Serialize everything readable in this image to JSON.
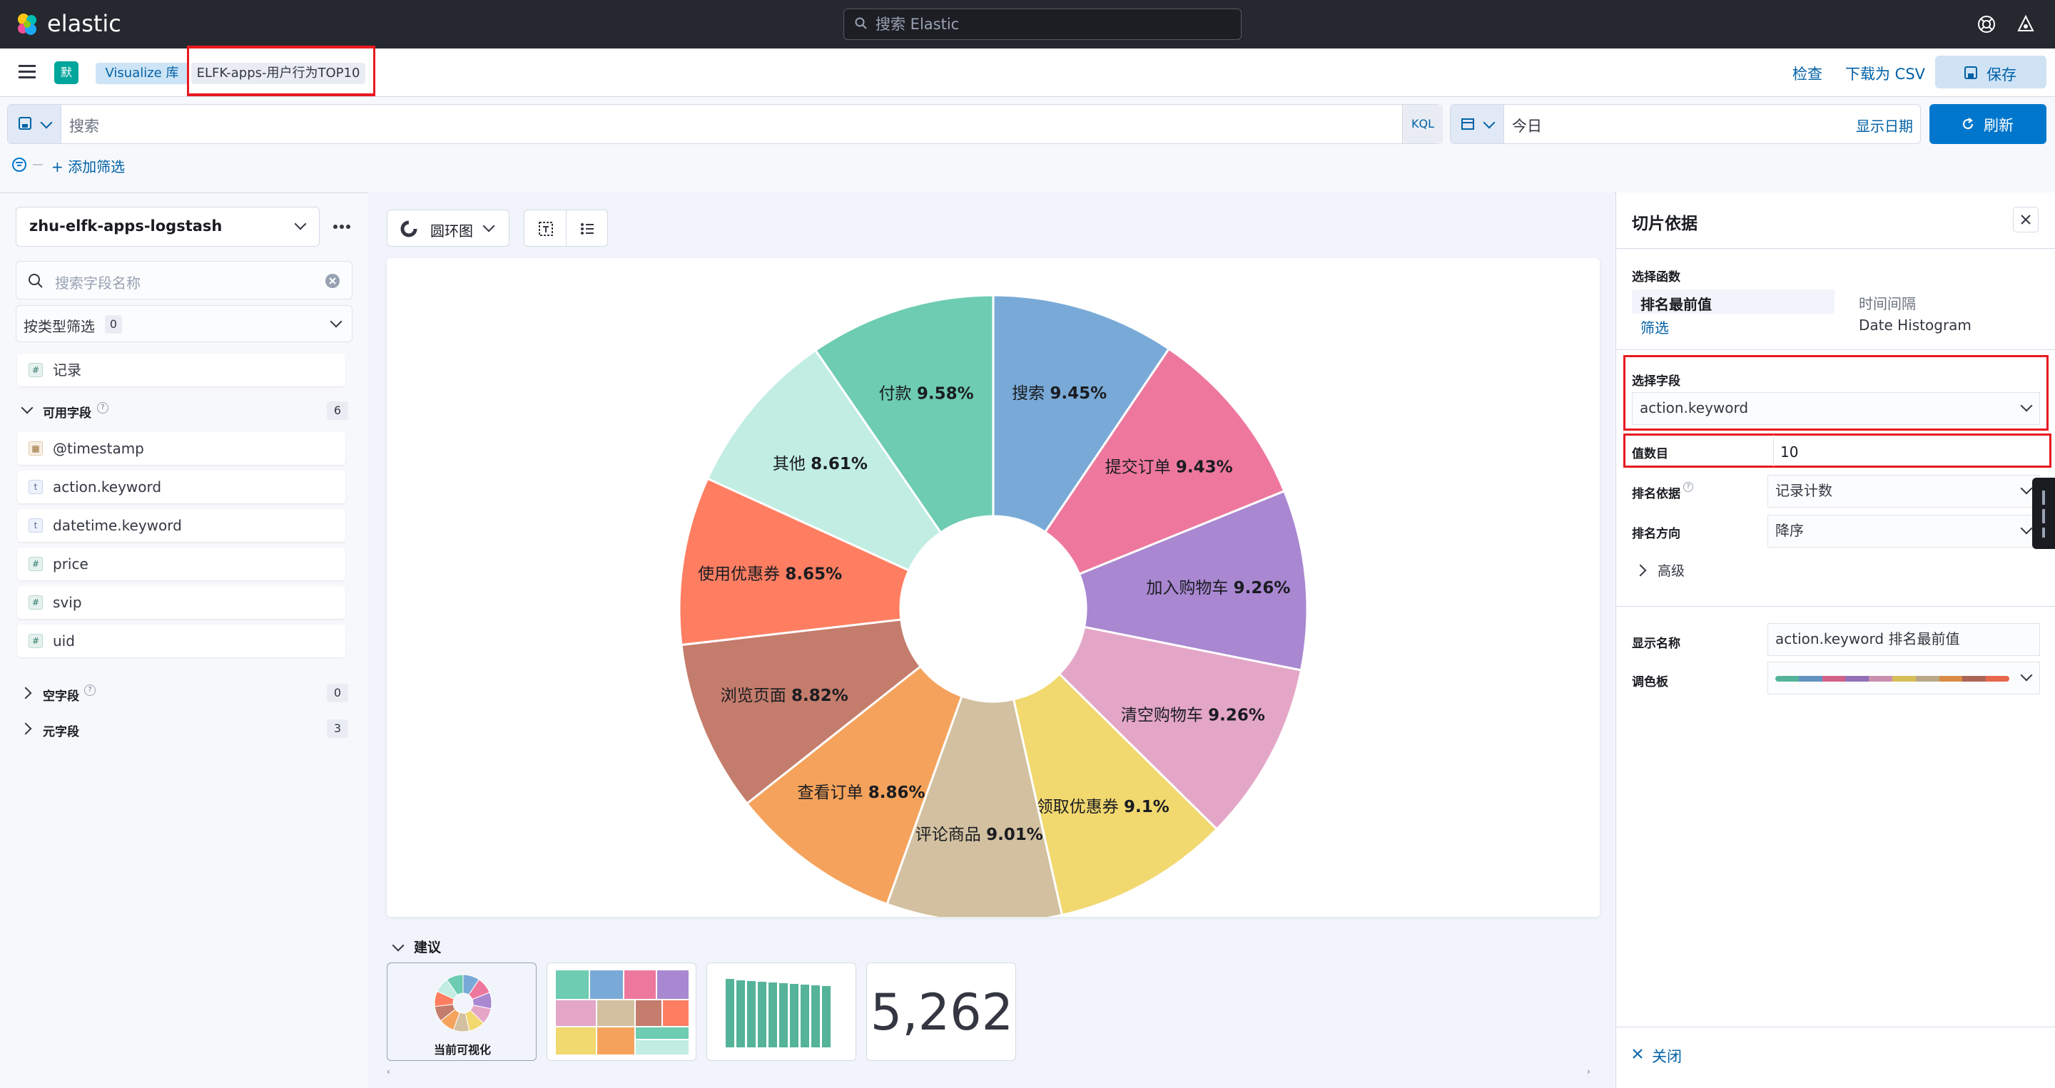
{
  "header": {
    "brand": "elastic",
    "search_placeholder": "搜索 Elastic"
  },
  "subbar": {
    "space_avatar": "默",
    "breadcrumb_root": "Visualize 库",
    "breadcrumb_current": "ELFK-apps-用户行为TOP10",
    "inspect": "检查",
    "download_csv": "下载为 CSV",
    "save": "保存"
  },
  "query": {
    "search_placeholder": "搜索",
    "kql": "KQL",
    "date_value": "今日",
    "show_dates": "显示日期",
    "refresh": "刷新",
    "add_filter": "+ 添加筛选"
  },
  "sidebar": {
    "index_pattern": "zhu-elfk-apps-logstash",
    "field_search_placeholder": "搜索字段名称",
    "filter_by_type": "按类型筛选",
    "filter_count": "0",
    "records": "记录",
    "available_fields": "可用字段",
    "available_count": "6",
    "fields": [
      {
        "name": "@timestamp",
        "type": "date"
      },
      {
        "name": "action.keyword",
        "type": "t"
      },
      {
        "name": "datetime.keyword",
        "type": "t"
      },
      {
        "name": "price",
        "type": "#"
      },
      {
        "name": "svip",
        "type": "#"
      },
      {
        "name": "uid",
        "type": "#"
      }
    ],
    "empty_fields": "空字段",
    "empty_count": "0",
    "meta_fields": "元字段",
    "meta_count": "3"
  },
  "toolbar": {
    "chart_type": "圆环图"
  },
  "chart_data": {
    "type": "pie",
    "donut": true,
    "slices": [
      {
        "label": "搜索",
        "value": 9.45,
        "text": "9.45%",
        "color": "#79aad7"
      },
      {
        "label": "提交订单",
        "value": 9.43,
        "text": "9.43%",
        "color": "#ee789d"
      },
      {
        "label": "加入购物车",
        "value": 9.26,
        "text": "9.26%",
        "color": "#a987d1"
      },
      {
        "label": "清空购物车",
        "value": 9.26,
        "text": "9.26%",
        "color": "#e4a6c7"
      },
      {
        "label": "领取优惠券",
        "value": 9.1,
        "text": "9.1%",
        "color": "#f1d86f"
      },
      {
        "label": "评论商品",
        "value": 9.01,
        "text": "9.01%",
        "color": "#d2c0a0"
      },
      {
        "label": "查看订单",
        "value": 8.86,
        "text": "8.86%",
        "color": "#f5a35c"
      },
      {
        "label": "浏览页面",
        "value": 8.82,
        "text": "8.82%",
        "color": "#c47c6c"
      },
      {
        "label": "使用优惠券",
        "value": 8.65,
        "text": "8.65%",
        "color": "#ff7e62"
      },
      {
        "label": "其他",
        "value": 8.61,
        "text": "8.61%",
        "color": "#c1ede3"
      },
      {
        "label": "付款",
        "value": 9.58,
        "text": "9.58%",
        "color": "#6dccb1"
      }
    ]
  },
  "suggestions": {
    "title": "建议",
    "current_label": "当前可视化",
    "metric_value": "5,262"
  },
  "panel": {
    "title": "切片依据",
    "select_function": "选择函数",
    "fn_top_values": "排名最前值",
    "fn_time_interval": "时间间隔",
    "fn_filters": "筛选",
    "fn_date_histogram": "Date Histogram",
    "select_field": "选择字段",
    "field_value": "action.keyword",
    "count_label": "值数目",
    "count_value": "10",
    "rank_by_label": "排名依据",
    "rank_by_value": "记录计数",
    "rank_dir_label": "排名方向",
    "rank_dir_value": "降序",
    "advanced": "高级",
    "display_name_label": "显示名称",
    "display_name_value": "action.keyword 排名最前值",
    "palette_label": "调色板",
    "palette_colors": [
      "#54b399",
      "#6092c0",
      "#d36086",
      "#9170b8",
      "#ca8eae",
      "#d6bf57",
      "#b9a888",
      "#da8b45",
      "#aa6556",
      "#e7664c"
    ],
    "close": "关闭"
  }
}
